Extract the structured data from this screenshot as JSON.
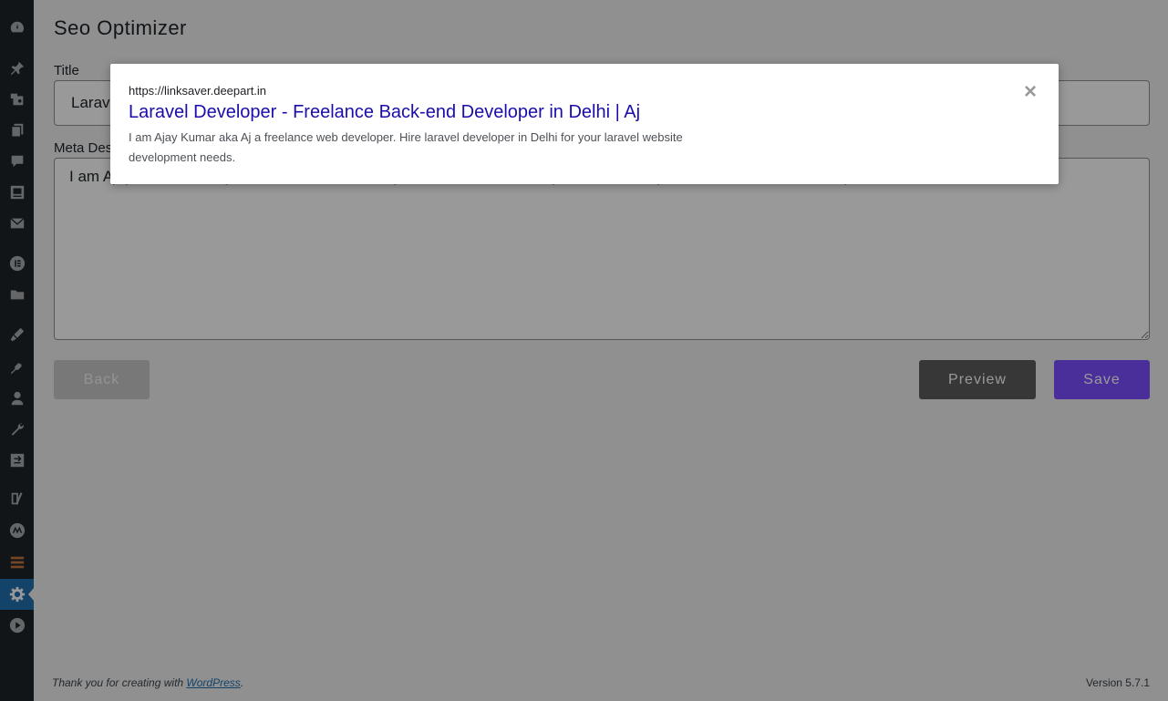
{
  "colors": {
    "sidebar_bg": "#1d2327",
    "active_item": "#2271b1",
    "save_button": "#7c4dff",
    "preview_button": "#5c5c5c",
    "serp_title": "#1a0dab"
  },
  "sidebar": {
    "items": [
      {
        "icon": "dashboard-icon"
      },
      {
        "icon": "pin-icon"
      },
      {
        "icon": "media-icon"
      },
      {
        "icon": "pages-icon"
      },
      {
        "icon": "comments-icon"
      },
      {
        "icon": "gallery-icon"
      },
      {
        "icon": "mail-icon"
      },
      {
        "icon": "elementor-icon"
      },
      {
        "icon": "folder-icon"
      },
      {
        "icon": "appearance-icon"
      },
      {
        "icon": "plugins-icon"
      },
      {
        "icon": "users-icon"
      },
      {
        "icon": "tools-icon"
      },
      {
        "icon": "transfer-icon"
      },
      {
        "icon": "yoast-icon"
      },
      {
        "icon": "wordfence-icon"
      },
      {
        "icon": "stack-icon"
      },
      {
        "icon": "settings-icon",
        "active": true
      },
      {
        "icon": "play-icon"
      }
    ]
  },
  "page": {
    "title": "Seo Optimizer",
    "title_label": "Title",
    "title_value": "Laravel Developer - Freelance Back-end Developer in Delhi | Aj",
    "meta_label": "Meta Description",
    "meta_value": "I am Ajay Kumar aka Aj a freelance web developer. Hire laravel developer in Delhi for your laravel website development needs."
  },
  "buttons": {
    "back": "Back",
    "preview": "Preview",
    "save": "Save"
  },
  "footer": {
    "thanks_prefix": "Thank you for creating with ",
    "wordpress_link": "WordPress",
    "thanks_suffix": ".",
    "version": "Version 5.7.1"
  },
  "modal": {
    "url": "https://linksaver.deepart.in",
    "serp_title": "Laravel Developer - Freelance Back-end Developer in Delhi | Aj",
    "serp_description": "I am Ajay Kumar aka Aj a freelance web developer. Hire laravel developer in Delhi for your laravel website development needs.",
    "close_glyph": "×"
  }
}
